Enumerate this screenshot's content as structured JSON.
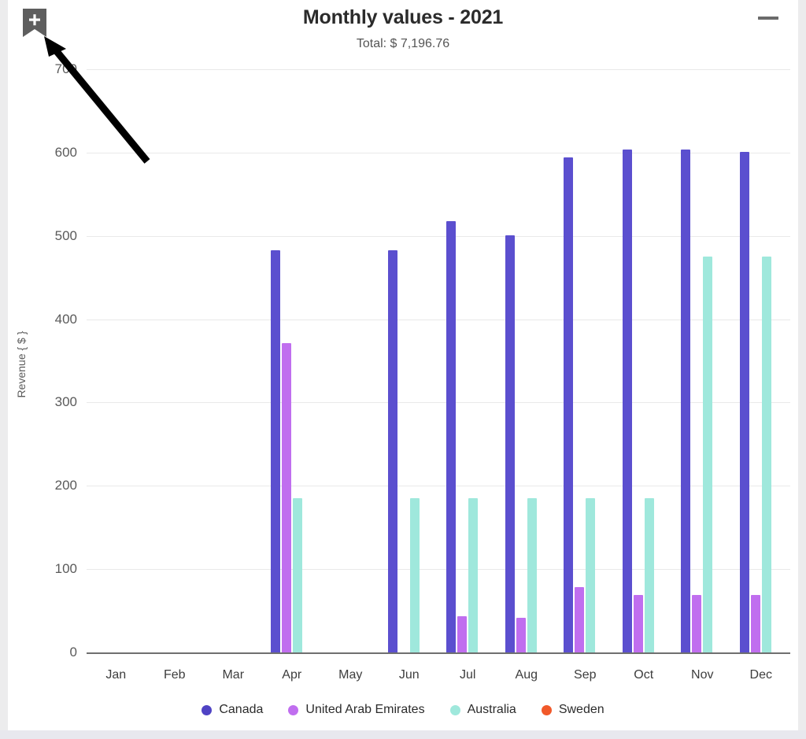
{
  "header": {
    "title": "Monthly values - 2021",
    "subtitle": "Total: $ 7,196.76",
    "bookmark_icon": "bookmark-plus-icon",
    "menu_icon": "hamburger-menu-icon"
  },
  "chart_data": {
    "type": "bar",
    "title": "Monthly values - 2021",
    "subtitle": "Total: $ 7,196.76",
    "xlabel": "",
    "ylabel": "Revenue { $ }",
    "ylim": [
      0,
      700
    ],
    "yticks": [
      0,
      100,
      200,
      300,
      400,
      500,
      600,
      700
    ],
    "ytick_labels": [
      "0",
      "100",
      "200",
      "300",
      "400",
      "500",
      "600",
      "700"
    ],
    "grid": true,
    "legend_position": "bottom",
    "categories": [
      "Jan",
      "Feb",
      "Mar",
      "Apr",
      "May",
      "Jun",
      "Jul",
      "Aug",
      "Sep",
      "Oct",
      "Nov",
      "Dec"
    ],
    "series": [
      {
        "name": "Canada",
        "color": "#5b4fcf",
        "values": [
          0,
          0,
          0,
          483,
          0,
          483,
          518,
          501,
          594,
          604,
          604,
          601
        ]
      },
      {
        "name": "United Arab Emirates",
        "color": "#c06eef",
        "values": [
          0,
          0,
          0,
          371,
          0,
          0,
          43,
          42,
          78,
          69,
          69,
          69
        ]
      },
      {
        "name": "Australia",
        "color": "#9fe8dc",
        "values": [
          0,
          0,
          0,
          185,
          0,
          185,
          185,
          185,
          185,
          185,
          475,
          475
        ]
      },
      {
        "name": "Sweden",
        "color": "#f1592a",
        "values": [
          0,
          0,
          0,
          0,
          0,
          0,
          0,
          0,
          0,
          0,
          0,
          0
        ]
      }
    ]
  },
  "legend": [
    {
      "label": "Canada",
      "color": "#4f43c4"
    },
    {
      "label": "United Arab Emirates",
      "color": "#c06eef"
    },
    {
      "label": "Australia",
      "color": "#9fe8dc"
    },
    {
      "label": "Sweden",
      "color": "#f1592a"
    }
  ],
  "annotation": {
    "type": "arrow",
    "color": "#000000",
    "points_to": "bookmark-plus-icon"
  },
  "colors": {
    "page_background": "#ececed",
    "card_background": "#ffffff",
    "gridline": "#e9e9e9",
    "axis": "#6f6f6f",
    "title_text": "#2b2b2b",
    "tick_text": "#5a5a5a"
  }
}
